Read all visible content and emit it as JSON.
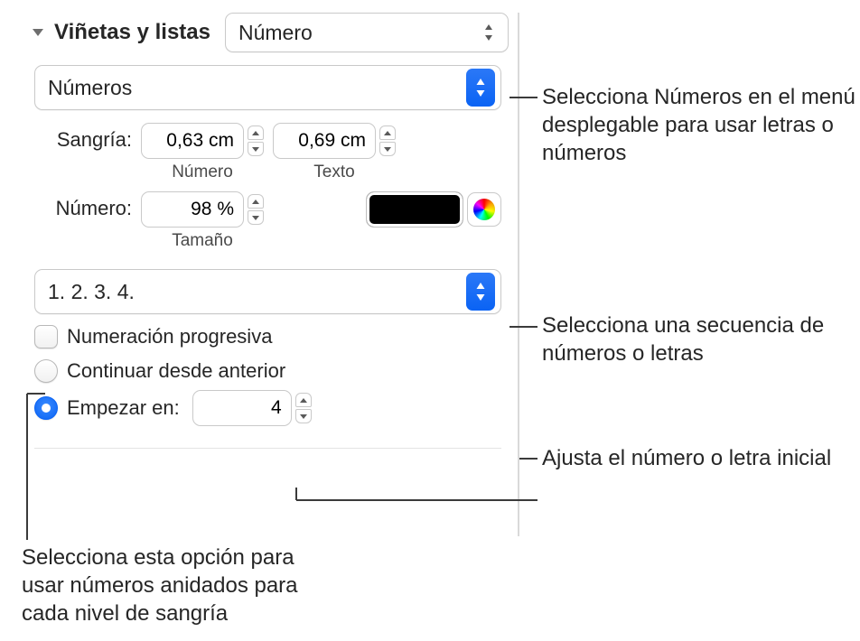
{
  "header": {
    "title": "Viñetas y listas",
    "style_popup": "Número"
  },
  "format_popup": "Números",
  "indent": {
    "label": "Sangría:",
    "number_value": "0,63 cm",
    "number_caption": "Número",
    "text_value": "0,69 cm",
    "text_caption": "Texto"
  },
  "number": {
    "label": "Número:",
    "size_value": "98 %",
    "size_caption": "Tamaño"
  },
  "sequence_popup": "1. 2. 3. 4.",
  "tiered": "Numeración progresiva",
  "continue": "Continuar desde anterior",
  "start": {
    "label": "Empezar en:",
    "value": "4"
  },
  "callouts": {
    "format": "Selecciona Números en el menú desplegable para usar letras o números",
    "sequence": "Selecciona una secuencia de números o letras",
    "start": "Ajusta el número o letra inicial",
    "tiered": "Selecciona esta opción para usar números anidados para cada nivel de sangría"
  }
}
